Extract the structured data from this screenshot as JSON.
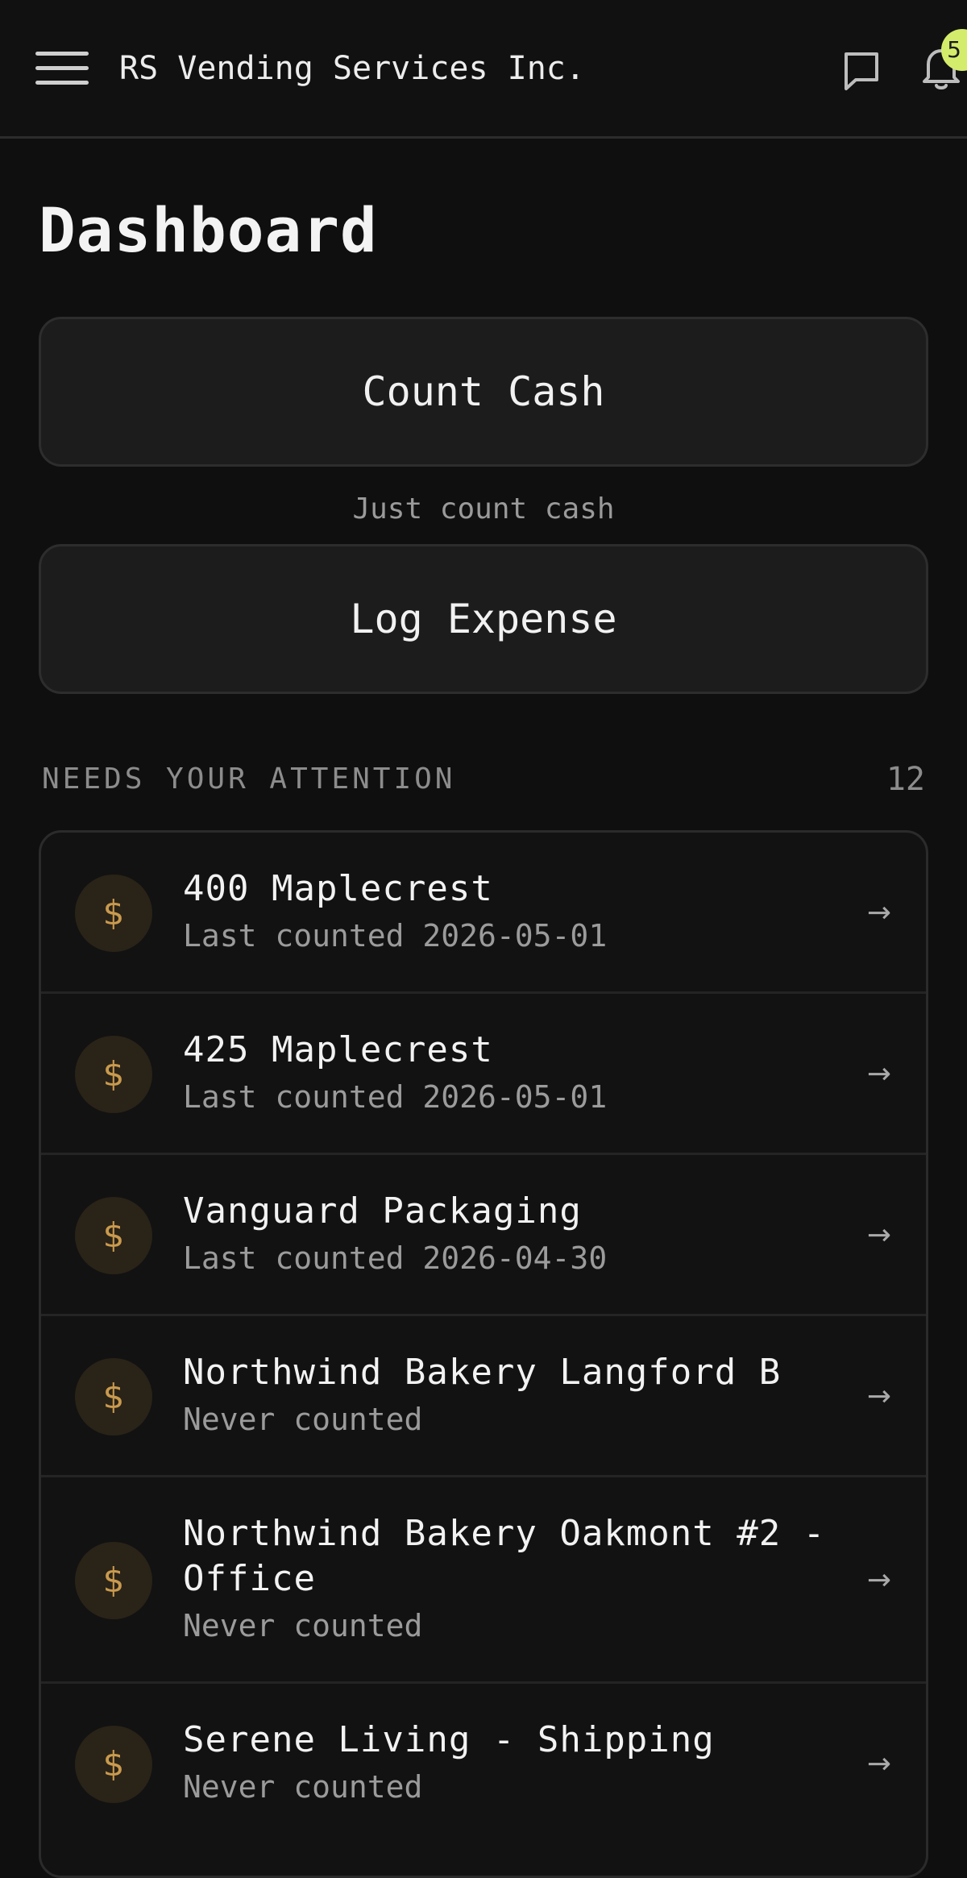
{
  "header": {
    "menu_icon": "hamburger-menu-icon",
    "title": "RS Vending Services Inc.",
    "messages_icon": "chat-bubble-icon",
    "notifications_icon": "bell-icon",
    "notifications_count": "5",
    "badge_color": "#d4ec6b"
  },
  "page": {
    "title": "Dashboard"
  },
  "actions": {
    "count_cash_label": "Count Cash",
    "count_cash_caption": "Just count cash",
    "log_expense_label": "Log Expense"
  },
  "attention": {
    "heading": "NEEDS YOUR ATTENTION",
    "count": "12",
    "icon": "dollar-icon",
    "icon_glyph": "$",
    "arrow_glyph": "→",
    "items": [
      {
        "name": "400 Maplecrest",
        "status": "Last counted 2026-05-01"
      },
      {
        "name": "425 Maplecrest",
        "status": "Last counted 2026-05-01"
      },
      {
        "name": "Vanguard Packaging",
        "status": "Last counted 2026-04-30"
      },
      {
        "name": "Northwind Bakery Langford B",
        "status": "Never counted"
      },
      {
        "name": "Northwind Bakery Oakmont #2 - Office",
        "status": "Never counted"
      },
      {
        "name": "Serene Living - Shipping",
        "status": "Never counted"
      }
    ]
  },
  "colors": {
    "background": "#0f0f0f",
    "card": "#1c1c1c",
    "accent_coin": "#c99a4e"
  }
}
